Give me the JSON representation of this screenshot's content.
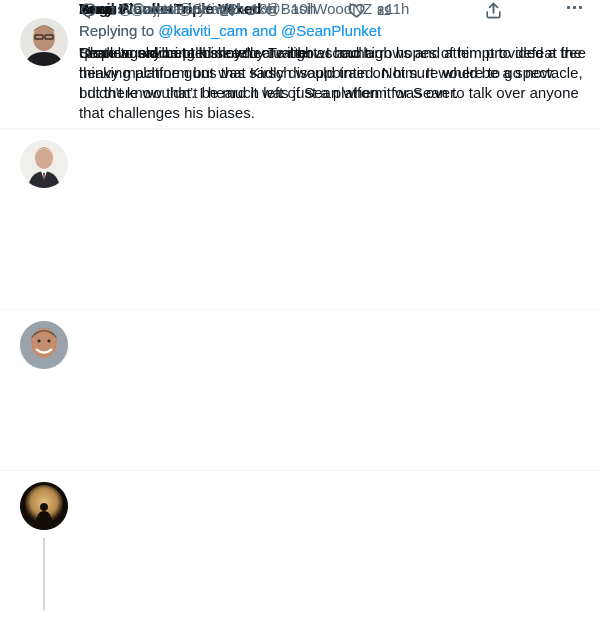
{
  "tweets": [
    {
      "name": "Sean Plunket",
      "handle": "@SeanPlunket",
      "time": "10h",
      "replying_prefix": "Replying to",
      "mentions": [
        "@kaiviti_cam"
      ],
      "mention_joiner": "",
      "body": "Challenge accepted see my Twitter account.",
      "replies": "5",
      "retweets": "",
      "likes": "3"
    },
    {
      "name": "Basil Wood - Triple Vexed",
      "handle": "@BasilWoodNZ",
      "time": "11h",
      "replying_prefix": "Replying to",
      "mentions": [
        "@kaiviti_cam",
        "@SeanPlunket"
      ],
      "mention_joiner": "and",
      "body": "\"popular online talk show\"\n\nI didn't know that. I heard it was just a platform for Sean to talk over anyone that challenges his biases.",
      "replies": "",
      "retweets": "",
      "likes": "8"
    },
    {
      "name": "Angus",
      "handle": "@ajpoleary",
      "time": "14h",
      "replying_prefix": "Replying to",
      "mentions": [
        "@kaiviti_cam",
        "@SeanPlunket"
      ],
      "mention_joiner": "and",
      "body": "Sean would bring his intellectual bows and arrows and attempt to defeat the heavy machine guns that Kirsch would train on him. It would be a spectacle, but there wouldn’t be much left of Sean when it was over.",
      "replies": "",
      "retweets": "",
      "likes": "11"
    },
    {
      "name": "Tony",
      "handle": "@FrustratedKiwi1",
      "time": "18h",
      "replying_prefix": "Replying to",
      "mentions": [
        "@kaiviti_cam",
        "@SeanPlunket"
      ],
      "mention_joiner": "and",
      "body": "I hate to say but I think you are right. I had high hopes of him provided a free thinking platform but was sadly disappointed. Not sure where to go now.",
      "replies": "1",
      "retweets": "2",
      "likes": "29"
    }
  ],
  "separator": "·",
  "icons": {
    "reply": "reply-icon",
    "retweet": "retweet-icon",
    "like": "heart-icon",
    "share": "share-icon",
    "more": "more-icon"
  },
  "colors": {
    "text": "#0f1419",
    "secondary": "#536471",
    "link": "#1d9bf0",
    "divider": "#eff3f4"
  }
}
